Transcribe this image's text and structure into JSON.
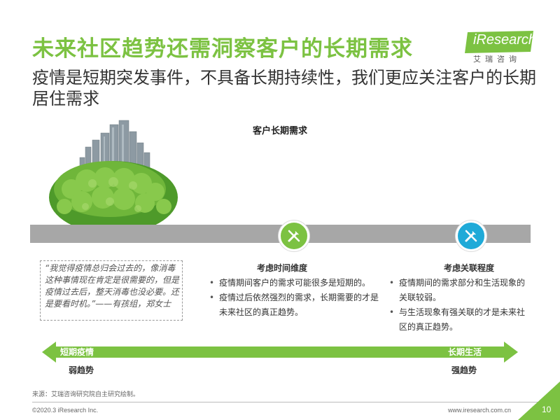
{
  "header": {
    "title": "未来社区趋势还需洞察客户的长期需求",
    "subtitle": "疫情是短期突发事件，不具备长期持续性，我们更应关注客户的长期居住需求"
  },
  "logo": {
    "word": "iResearch",
    "cn": "艾瑞咨询"
  },
  "section_title": "客户长期需求",
  "quote": "“我觉得疫情总归会过去的，像消毒这种事情现在肯定是很需要的，但是疫情过去后，整天消毒也没必要。还是要看时机。”——有孩组，郑女士",
  "columns": [
    {
      "title": "考虑时间维度",
      "bullets": [
        "疫情期间客户的需求可能很多是短期的。",
        "疫情过后依然强烈的需求，长期需要的才是未来社区的真正趋势。"
      ]
    },
    {
      "title": "考虑关联程度",
      "bullets": [
        "疫情期间的需求部分和生活现象的关联较弱。",
        "与生活现象有强关联的才是未来社区的真正趋势。"
      ]
    }
  ],
  "arrow": {
    "left_label": "短期疫情",
    "right_label": "长期生活",
    "weak": "弱趋势",
    "strong": "强趋势"
  },
  "footer": {
    "source": "来源：艾瑞咨询研究院自主研究绘制。",
    "copyright": "©2020.3 iResearch Inc.",
    "website": "www.iresearch.com.cn",
    "page": "10"
  },
  "colors": {
    "green": "#7cc242",
    "blue": "#1faad8",
    "bar_gray": "#a7a7a7"
  },
  "icons": [
    "green-hill-city-image",
    "tools-icon",
    "tools-icon"
  ]
}
